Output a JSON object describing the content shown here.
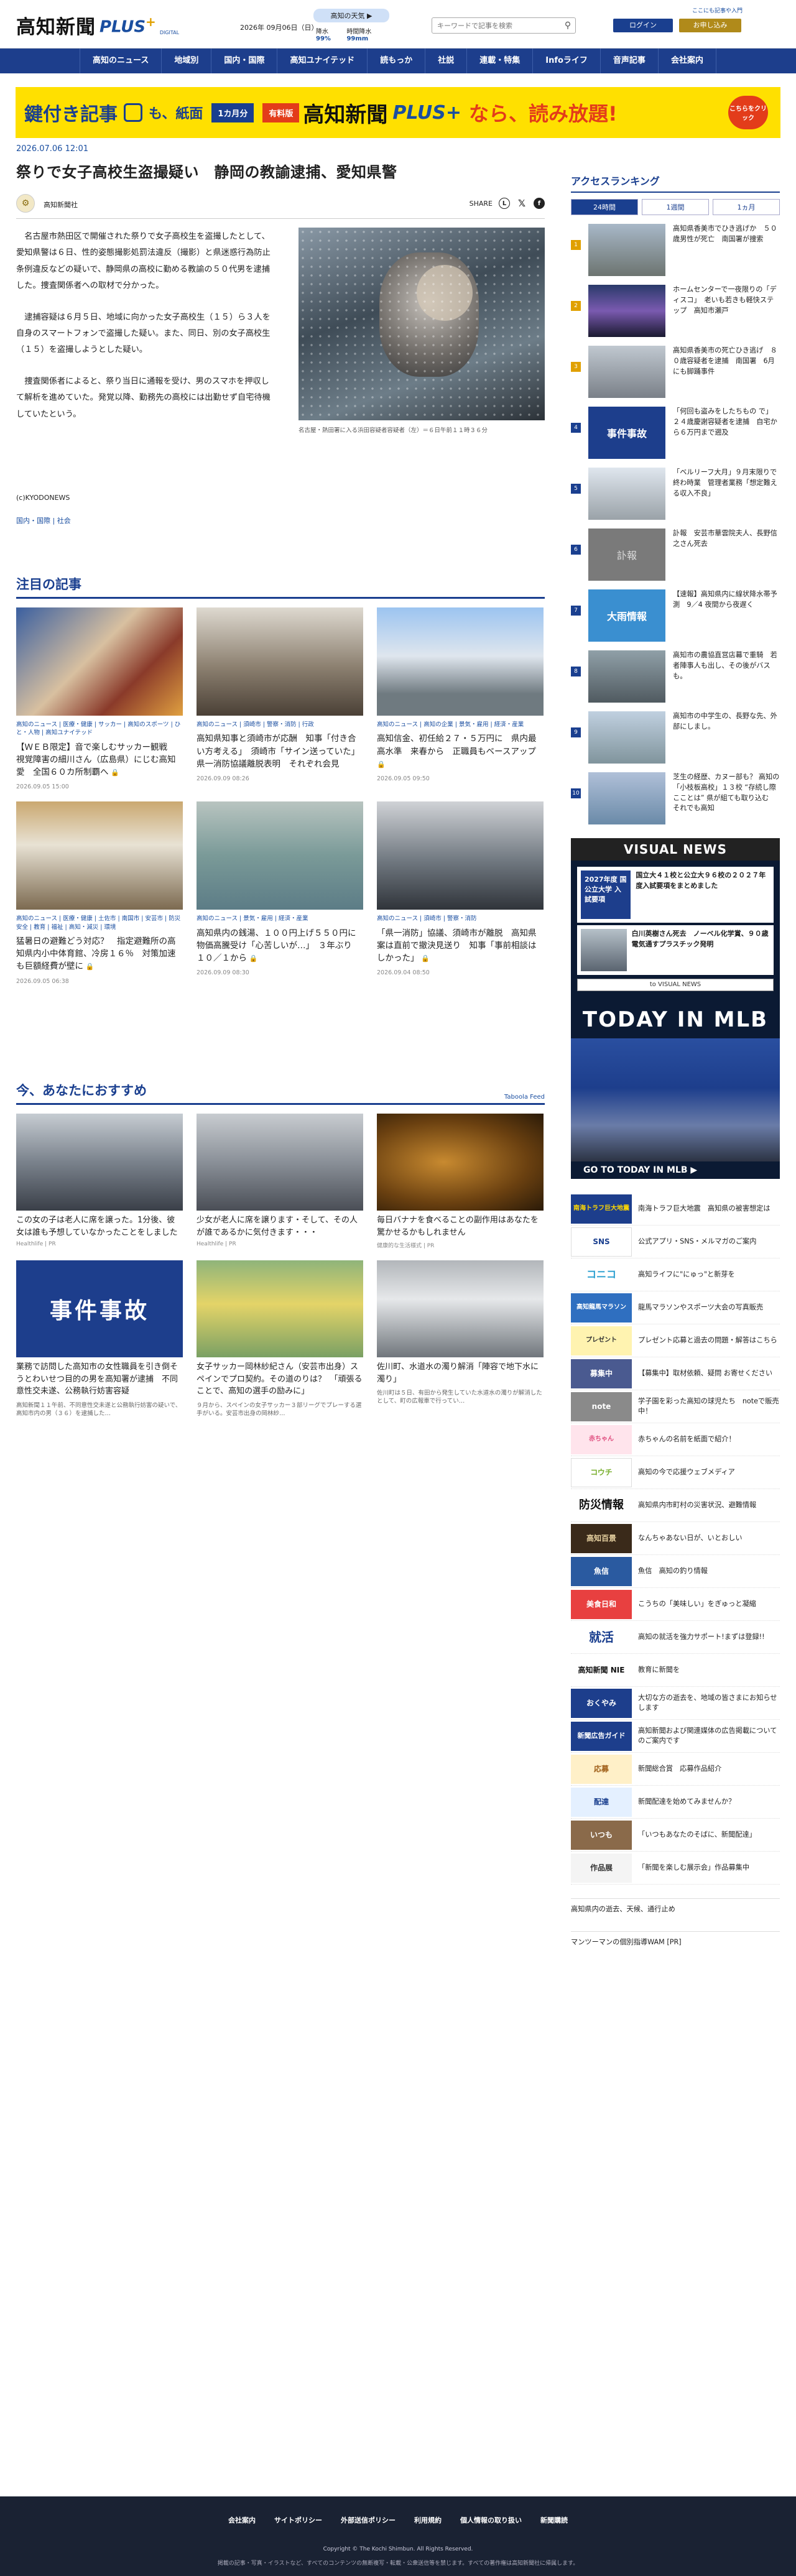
{
  "header": {
    "logo_jp": "高知新聞",
    "logo_plus": "PLUS",
    "logo_plus_mark": "+",
    "logo_digital": "DIGITAL",
    "date": "2026年 09月06日（日）",
    "weather_title": "高知の天気 ▶",
    "weather_items": [
      {
        "label": "降水",
        "value": "99%"
      },
      {
        "label": "時間降水",
        "value": "99mm"
      }
    ],
    "search_placeholder": "キーワードで記事を検索",
    "top_link": "ここにも記事や入門",
    "login": "ログイン",
    "signup": "お申し込み"
  },
  "nav": [
    "高知のニュース",
    "地域別",
    "国内・国際",
    "高知ユナイテッド",
    "読もっか",
    "社説",
    "連載・特集",
    "Infoライフ",
    "音声記事",
    "会社案内"
  ],
  "banner": {
    "text1": "鍵付き記事",
    "text2": "も、紙面",
    "month": "1カ月分",
    "paid": "有料版",
    "name": "高知新聞",
    "plus": "PLUS+",
    "read": "なら、読み放題!",
    "click": "こちらをクリック"
  },
  "article": {
    "published": "2026.07.06 12:01",
    "title": "祭りで女子高校生盗撮疑い　静岡の教諭逮捕、愛知県警",
    "author": "高知新聞社",
    "share_label": "SHARE",
    "paragraphs": [
      "名古屋市熱田区で開催された祭りで女子高校生を盗撮したとして、愛知県警は６日、性的姿態撮影処罰法違反（撮影）と県迷惑行為防止条例違反などの疑いで、静岡県の高校に勤める教諭の５０代男を逮捕した。捜査関係者への取材で分かった。",
      "逮捕容疑は６月５日、地域に向かった女子高校生（１５）ら３人を自身のスマートフォンで盗撮した疑い。また、同日、別の女子高校生（１５）を盗撮しようとした疑い。",
      "捜査関係者によると、祭り当日に通報を受け、男のスマホを押収して解析を進めていた。発覚以降、勤務先の高校には出勤せず自宅待機していたという。"
    ],
    "photo_caption": "名古屋・熱田署に入る浜田容疑者容疑者（左）＝６日午前１１時３６分",
    "credit": "(c)KYODONEWS",
    "tags": "国内・国際 | 社会"
  },
  "featured": {
    "heading": "注目の記事",
    "cards": [
      {
        "cats": "高知のニュース | 医療・健康 | サッカー | 高知のスポーツ | ひと・人物 | 高知ユナイテッド",
        "title": "【ＷＥＢ限定】音で楽しむサッカー観戦　視覚障害の細川さん（広島県）にじむ高知愛　全国６０カ所制覇へ",
        "date": "2026.09.05 15:00"
      },
      {
        "cats": "高知のニュース | 須崎市 | 警察・消防 | 行政",
        "title": "高知県知事と須崎市が応酬　知事「付き合い方考える」　須崎市「サイン送っていた」　県一消防協議離脱表明　それぞれ会見",
        "date": "2026.09.09 08:26"
      },
      {
        "cats": "高知のニュース | 高知の企業 | 景気・雇用 | 経済・産業",
        "title": "高知信金、初任給２７・５万円に　県内最高水準　来春から　正職員もベースアップ",
        "date": "2026.09.05 09:50"
      },
      {
        "cats": "高知のニュース | 医療・健康 | 土佐市 | 南国市 | 安芸市 | 防災安全 | 教育 | 福祉 | 高知・減災 | 環境",
        "title": "猛暑日の避難どう対応？　指定避難所の高知県内小中体育館、冷房１６％　対策加速も巨額経費が壁に",
        "date": "2026.09.05 06:38"
      },
      {
        "cats": "高知のニュース | 景気・雇用 | 経済・産業",
        "title": "高知県内の銭湯、１００円上げ５５０円に　物価高騰受け「心苦しいが…」　３年ぶり　１０／１から",
        "date": "2026.09.09 08:30"
      },
      {
        "cats": "高知のニュース | 須崎市 | 警察・消防",
        "title": "「県一消防」協議、須崎市が離脱　高知県案は直前で撤決見送り　知事「事前相談はしかった」",
        "date": "2026.09.04 08:50"
      }
    ]
  },
  "recommend": {
    "heading": "今、あなたにおすすめ",
    "provider": "Taboola Feed",
    "cards": [
      {
        "title": "この女の子は老人に席を譲った。1分後、彼女は誰も予想していなかったことをしました",
        "source": "Healthlife | PR",
        "desc": ""
      },
      {
        "title": "少女が老人に席を譲ります・そして、その人が誰であるかに気付きます・・・",
        "source": "Healthlife | PR",
        "desc": ""
      },
      {
        "title": "毎日バナナを食べることの副作用はあなたを驚かせるかもしれません",
        "source": "健康的な生活様式 | PR",
        "desc": ""
      },
      {
        "title": "業務で訪問した高知市の女性職員を引き倒そうとわいせつ目的の男を高知署が逮捕　不同意性交未遂、公務執行妨害容疑",
        "source": "",
        "desc": "高知新聞１１午前、不同意性交未遂と公務執行妨害の疑いで、高知市内の男（３６）を逮捕した…"
      },
      {
        "title": "女子サッカー岡林紗紀さん（安芸市出身）スペインでプロ契約。その道のりは？　「頑張ることで、高知の選手の励みに」",
        "source": "",
        "desc": "９月から、スペインの女子サッカー３部リーグでプレーする選手がいる。安芸市出身の岡林紗…"
      },
      {
        "title": "佐川町、水道水の濁り解消「陣容で地下水に濁り」",
        "source": "",
        "desc": "佐川町は５日、有田から発生していた水道水の濁りが解消したとして、町の広報車で行ってい…"
      }
    ]
  },
  "ranking": {
    "heading": "アクセスランキング",
    "tabs": [
      "24時間",
      "1週間",
      "1ヵ月"
    ],
    "items": [
      "高知県香美市でひき逃げか　５０歳男性が死亡　南国署が捜索",
      "ホームセンターで一夜限りの「ディスコ」　老いも若きも軽快ステップ　高知市瀬戸",
      "高知県香美市の死亡ひき逃げ　８０歳容疑者を逮捕　南国署　6月にも脚踊事件",
      "「何回も盗みをしたちもの で」　２４歳慶謝容疑者を逮捕　自宅から６万円まで遡及",
      "「ベルリーフ大月」９月末限りで終わ時業　管理者業務「想定難える収入不良」",
      "訃報　安芸市華雲院夫人、長野信之さん死去",
      "【速報】高知県内に線状降水帯予測　9／4 夜間から夜遅く",
      "高知市の農協直営店幕で重騎　若者陣事人も出し、その後がバスも。",
      "高知市の中学生の、長野な先、外部にしまし。",
      "芝生の経歴、カヌー部も？ 高知の「小枝板高校」１３校 “存続し際こことは” 県が組ても取り込む　それでも高知"
    ]
  },
  "visual_news": {
    "heading": "VISUAL NEWS",
    "card1_badge": "2027年度 国公立大学 入試要項",
    "card1_text": "国立大４１校と公立大９６校の２０２７年度入試要項をまとめました",
    "card2_text": "白川英樹さん死去　ノーベル化学賞、９０歳　電気通すプラスチック発明",
    "link": "to VISUAL NEWS",
    "mlb": "TODAY IN MLB",
    "mlb_footer": "GO TO TODAY IN MLB ▶"
  },
  "side_links": [
    {
      "icon": "南海トラフ巨大地震",
      "text": "南海トラフ巨大地震　高知県の被害想定は"
    },
    {
      "icon": "SNS",
      "text": "公式アプリ・SNS・メルマガのご案内"
    },
    {
      "icon": "コニコ",
      "text": "高知ライフに\"にゅっ\"と新芽を"
    },
    {
      "icon": "高知龍馬マラソン",
      "text": "龍馬マラソンやスポーツ大会の写真販売"
    },
    {
      "icon": "プレゼント",
      "text": "プレゼント応募と過去の問題・解答はこちら"
    },
    {
      "icon": "募集中",
      "text": "【募集中】取材依頼、疑問 お寄せください"
    },
    {
      "icon": "note",
      "text": "学子園を彩った高知の球児たち　noteで販売中！"
    },
    {
      "icon": "赤ちゃん",
      "text": "赤ちゃんの名前を紙面で紹介！"
    },
    {
      "icon": "コウチ",
      "text": "高知の今で応援ウェブメディア"
    },
    {
      "icon": "防災情報",
      "text": "高知県内市町村の災害状況、避難情報"
    },
    {
      "icon": "高知百景",
      "text": "なんちゃあない日が、いとおしい"
    },
    {
      "icon": "魚信",
      "text": "魚信　高知の釣り情報"
    },
    {
      "icon": "美食日和",
      "text": "こうちの「美味しい」をぎゅっと凝縮"
    },
    {
      "icon": "就活",
      "text": "高知の就活を強力サポート!まずは登録!!"
    },
    {
      "icon": "高知新聞 NIE",
      "text": "教育に新聞を"
    },
    {
      "icon": "おくやみ",
      "text": "大切な方の逝去を、地域の皆さまにお知らせします"
    },
    {
      "icon": "新聞広告ガイド",
      "text": "高知新聞および関連媒体の広告掲載についてのご案内です"
    },
    {
      "icon": "応募",
      "text": "新聞総合賞　応募作品紹介"
    },
    {
      "icon": "配達",
      "text": "新聞配達を始めてみませんか？"
    },
    {
      "icon": "いつも",
      "text": "「いつもあなたのそばに、新聞配達」"
    },
    {
      "icon": "作品展",
      "text": "「新聞を楽しむ展示会」作品募集中"
    }
  ],
  "side_extra": "高知県内の逝去、天候、通行止め",
  "side_ad": "マンツーマンの個別指導WAM [PR]",
  "footer": {
    "links": [
      "会社案内",
      "サイトポリシー",
      "外部送信ポリシー",
      "利用規約",
      "個人情報の取り扱い",
      "新聞購読"
    ],
    "copyright": "Copyright © The Kochi Shimbun. All Rights Reserved.",
    "notice": "掲載の記事・写真・イラストなど、すべてのコンテンツの無断複写・転載・公衆送信等を禁じます。すべての著作権は高知新聞社に帰属します。"
  }
}
